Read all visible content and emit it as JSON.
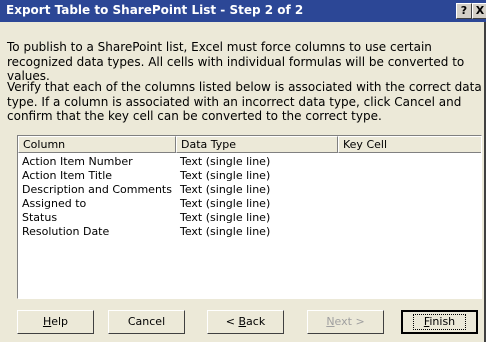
{
  "window": {
    "title": "Export Table to SharePoint List - Step 2 of 2",
    "help_glyph": "?",
    "close_glyph": "X"
  },
  "description": {
    "para1": "To publish to a SharePoint list, Excel must force columns to use certain recognized data types.  All cells with individual formulas will be converted to values.",
    "para2": "Verify that each of the columns listed below is associated with the correct data type. If a column is associated with an incorrect data type, click Cancel and confirm that the key cell can be converted to the correct type."
  },
  "table": {
    "headers": [
      "Column",
      "Data Type",
      "Key Cell"
    ],
    "rows": [
      {
        "column": "Action Item Number",
        "data_type": "Text (single line)",
        "key_cell": ""
      },
      {
        "column": "Action Item Title",
        "data_type": "Text (single line)",
        "key_cell": ""
      },
      {
        "column": "Description and Comments",
        "data_type": "Text (single line)",
        "key_cell": ""
      },
      {
        "column": "Assigned to",
        "data_type": "Text (single line)",
        "key_cell": ""
      },
      {
        "column": "Status",
        "data_type": "Text (single line)",
        "key_cell": ""
      },
      {
        "column": "Resolution Date",
        "data_type": "Text (single line)",
        "key_cell": ""
      }
    ]
  },
  "buttons": {
    "help": {
      "mnemonic": "H",
      "rest": "elp"
    },
    "cancel": {
      "label": "Cancel"
    },
    "back": {
      "prefix": "< ",
      "mnemonic": "B",
      "rest": "ack"
    },
    "next": {
      "mnemonic": "N",
      "rest": "ext >",
      "disabled": true
    },
    "finish": {
      "mnemonic": "F",
      "rest": "inish"
    }
  }
}
